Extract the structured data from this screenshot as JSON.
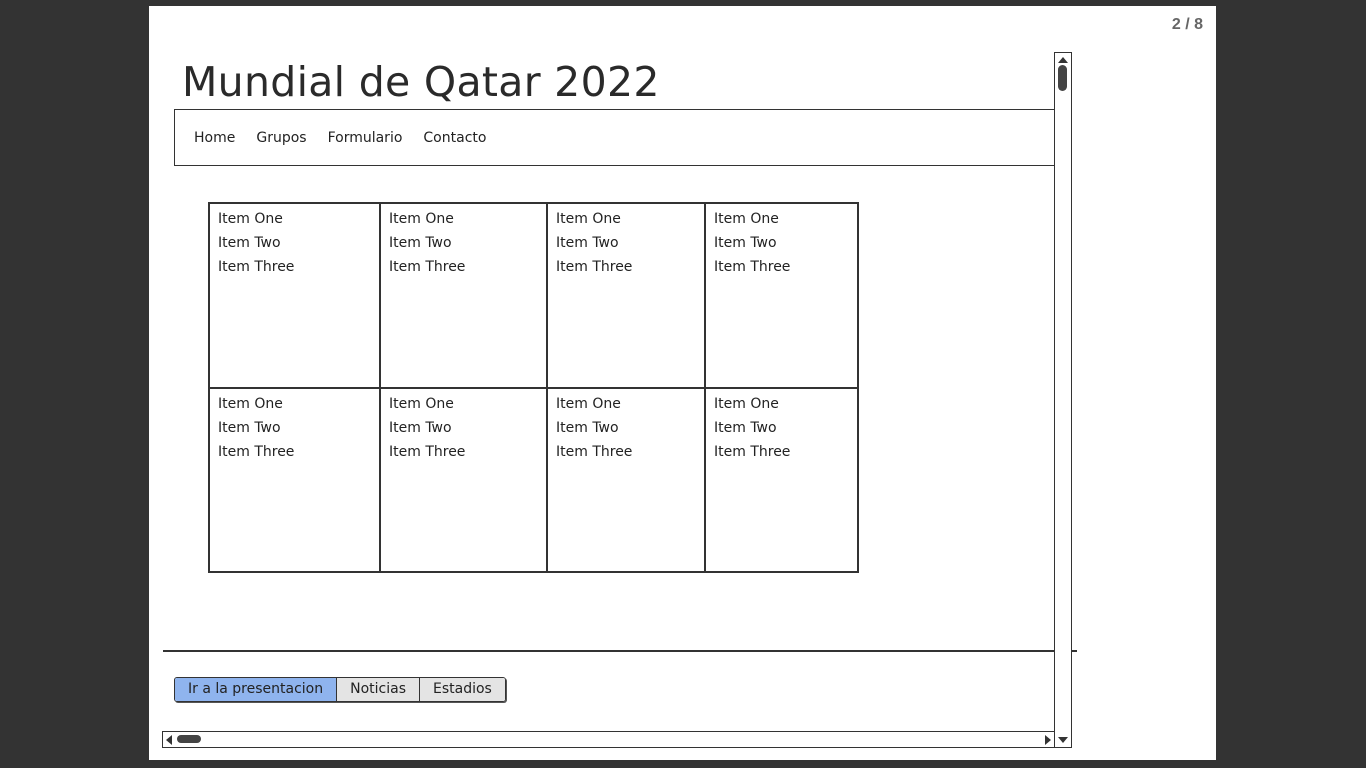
{
  "page_counter": "2 / 8",
  "title": "Mundial de Qatar 2022",
  "nav": {
    "items": [
      "Home",
      "Grupos",
      "Formulario",
      "Contacto"
    ]
  },
  "grid": {
    "rows": [
      [
        [
          "Item One",
          "Item Two",
          "Item Three"
        ],
        [
          "Item One",
          "Item Two",
          "Item Three"
        ],
        [
          "Item One",
          "Item Two",
          "Item Three"
        ],
        [
          "Item One",
          "Item Two",
          "Item Three"
        ]
      ],
      [
        [
          "Item One",
          "Item Two",
          "Item Three"
        ],
        [
          "Item One",
          "Item Two",
          "Item Three"
        ],
        [
          "Item One",
          "Item Two",
          "Item Three"
        ],
        [
          "Item One",
          "Item Two",
          "Item Three"
        ]
      ]
    ]
  },
  "button_bar": {
    "buttons": [
      "Ir a la presentacion",
      "Noticias",
      "Estadios"
    ],
    "active_index": 0,
    "active_color": "#8fb4ee"
  }
}
